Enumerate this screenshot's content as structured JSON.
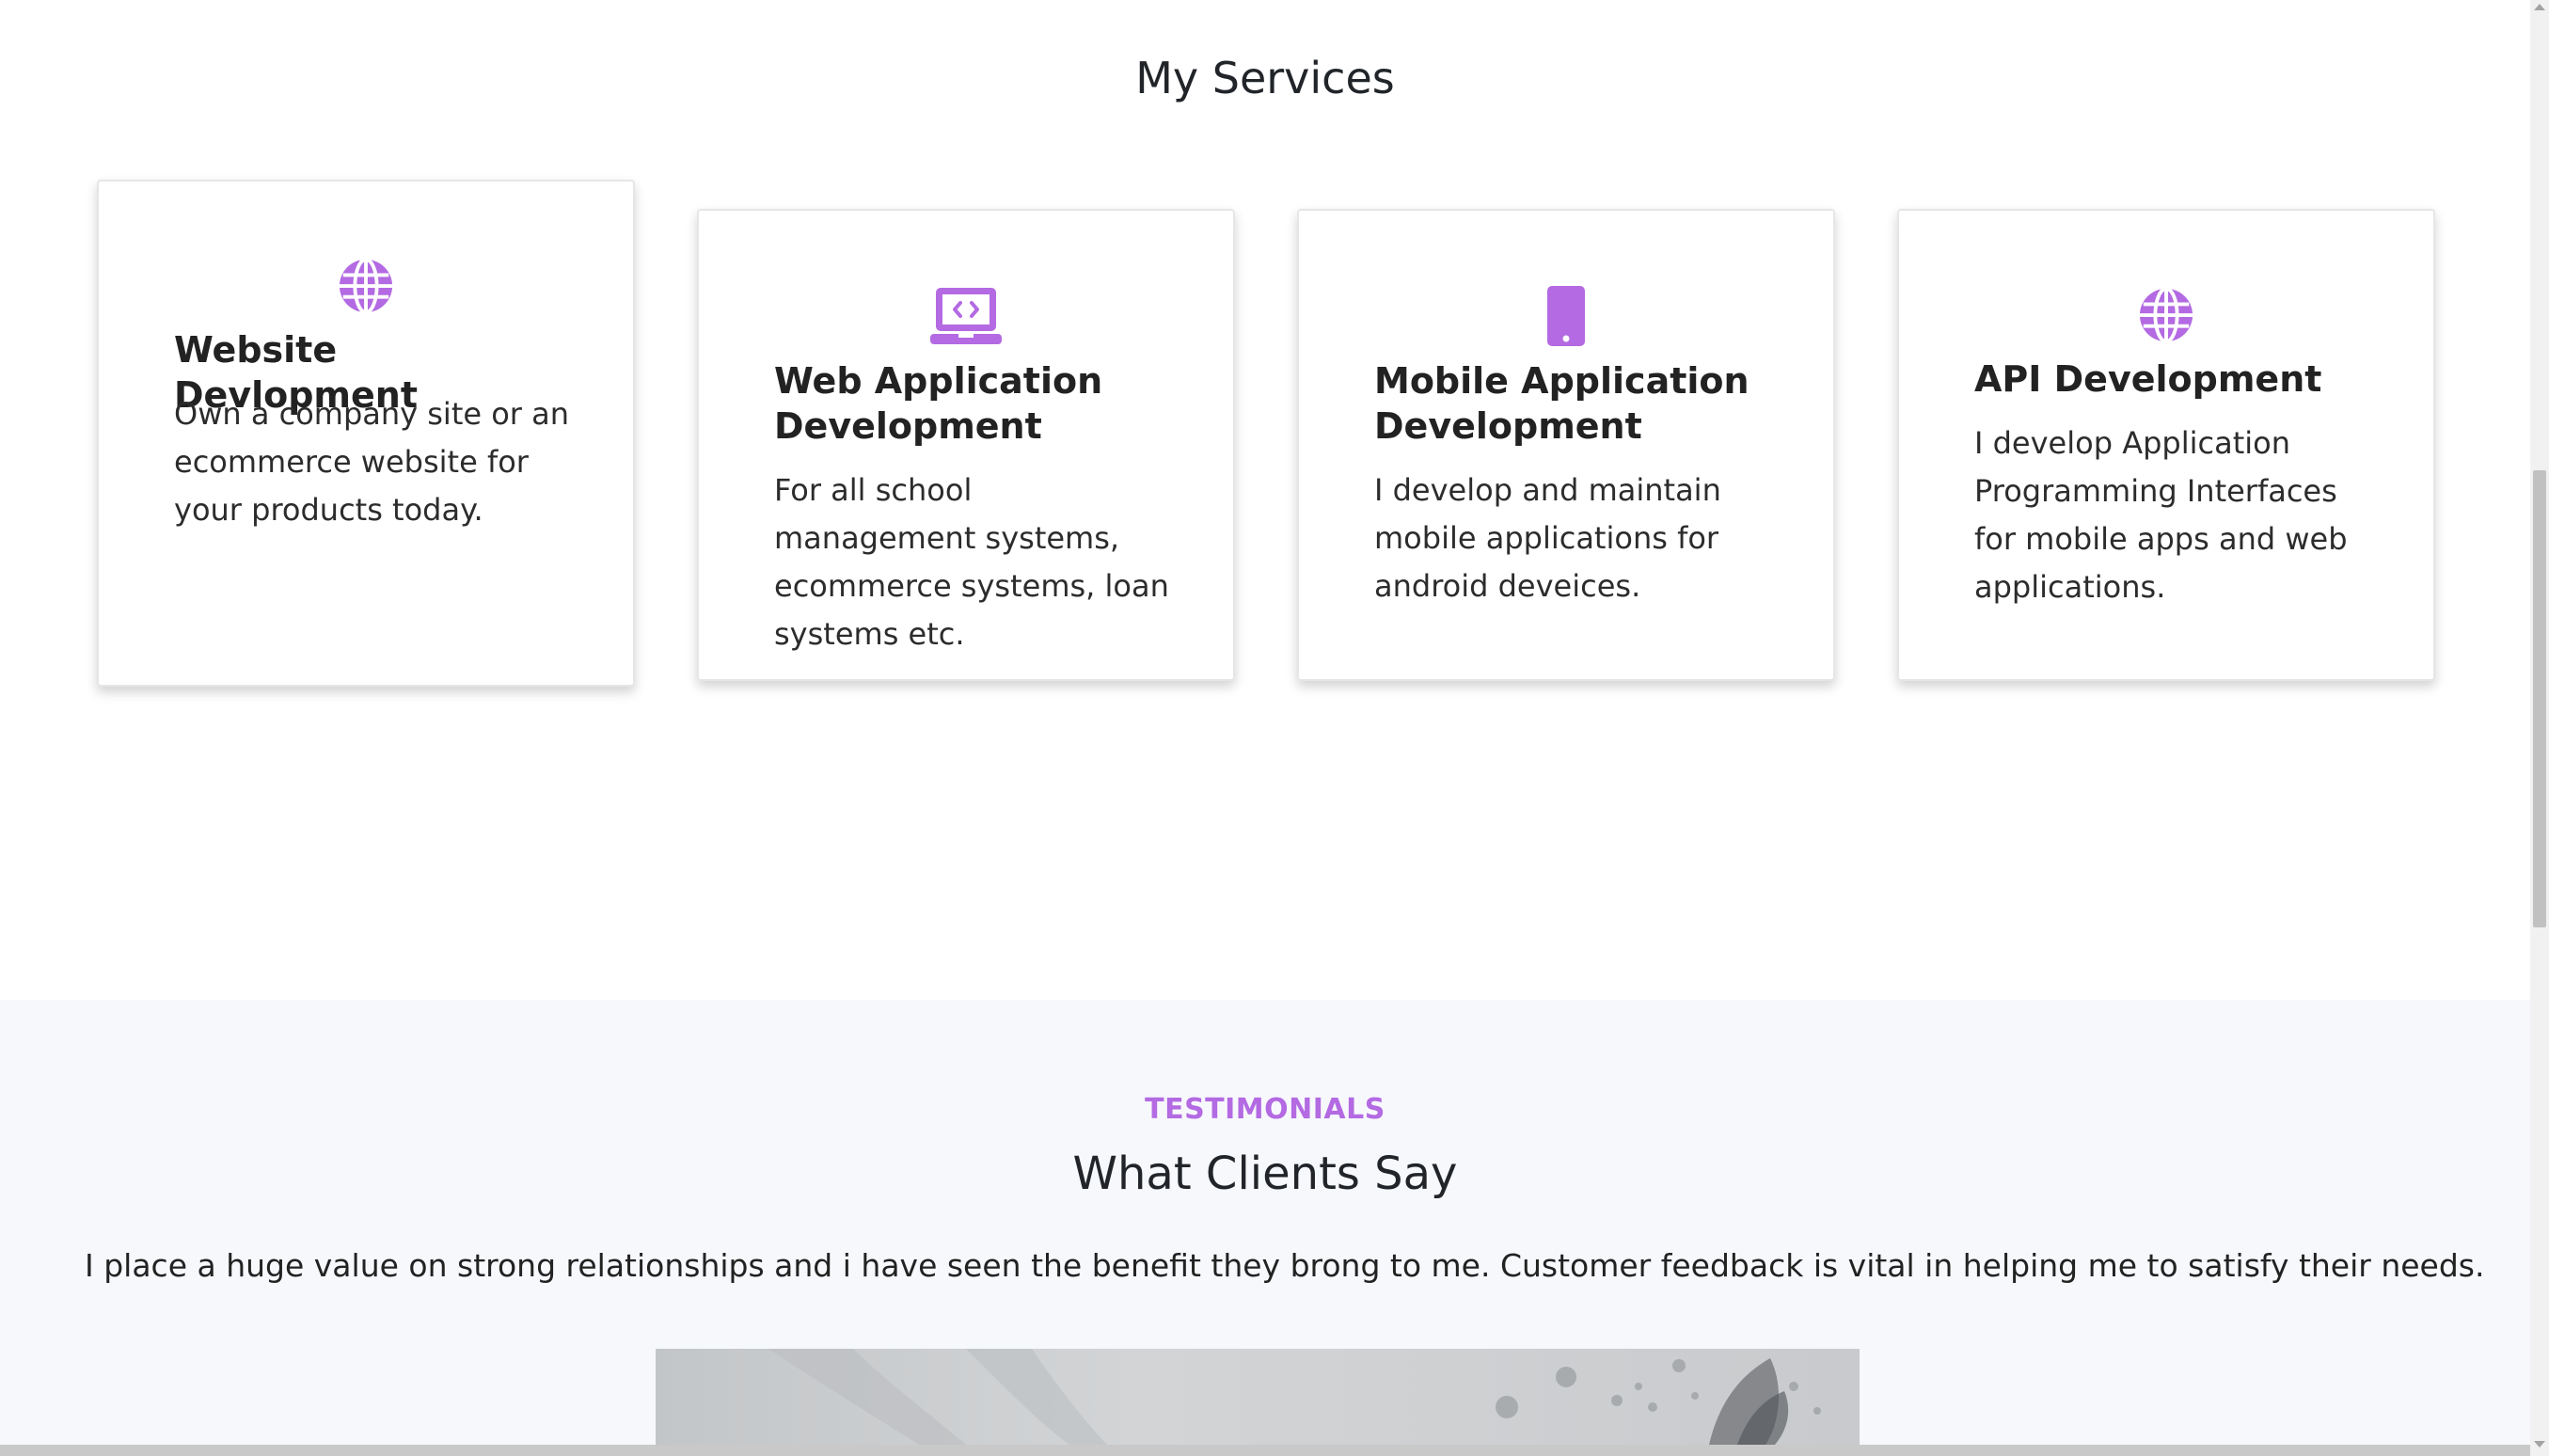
{
  "services": {
    "title": "My Services",
    "cards": [
      {
        "icon": "globe-icon",
        "title": "Website Devlopment",
        "text": "Own a company site or an ecommerce website for your products today."
      },
      {
        "icon": "laptop-code-icon",
        "title": "Web Application Development",
        "text": "For all school management systems, ecommerce systems, loan systems etc."
      },
      {
        "icon": "mobile-phone-icon",
        "title": "Mobile Application Development",
        "text": "I develop and maintain mobile applications for android deveices."
      },
      {
        "icon": "globe-icon",
        "title": "API Development",
        "text": "I develop Application Programming Interfaces for mobile apps and web applications."
      }
    ]
  },
  "testimonials": {
    "eyebrow": "TESTIMONIALS",
    "title": "What Clients Say",
    "intro": "I place a huge value on strong relationships and i have seen the benefit they brong to me. Customer feedback is vital in helping me to satisfy their needs."
  },
  "colors": {
    "accent": "#b36ae2",
    "section_bg": "#f7f8fc"
  }
}
